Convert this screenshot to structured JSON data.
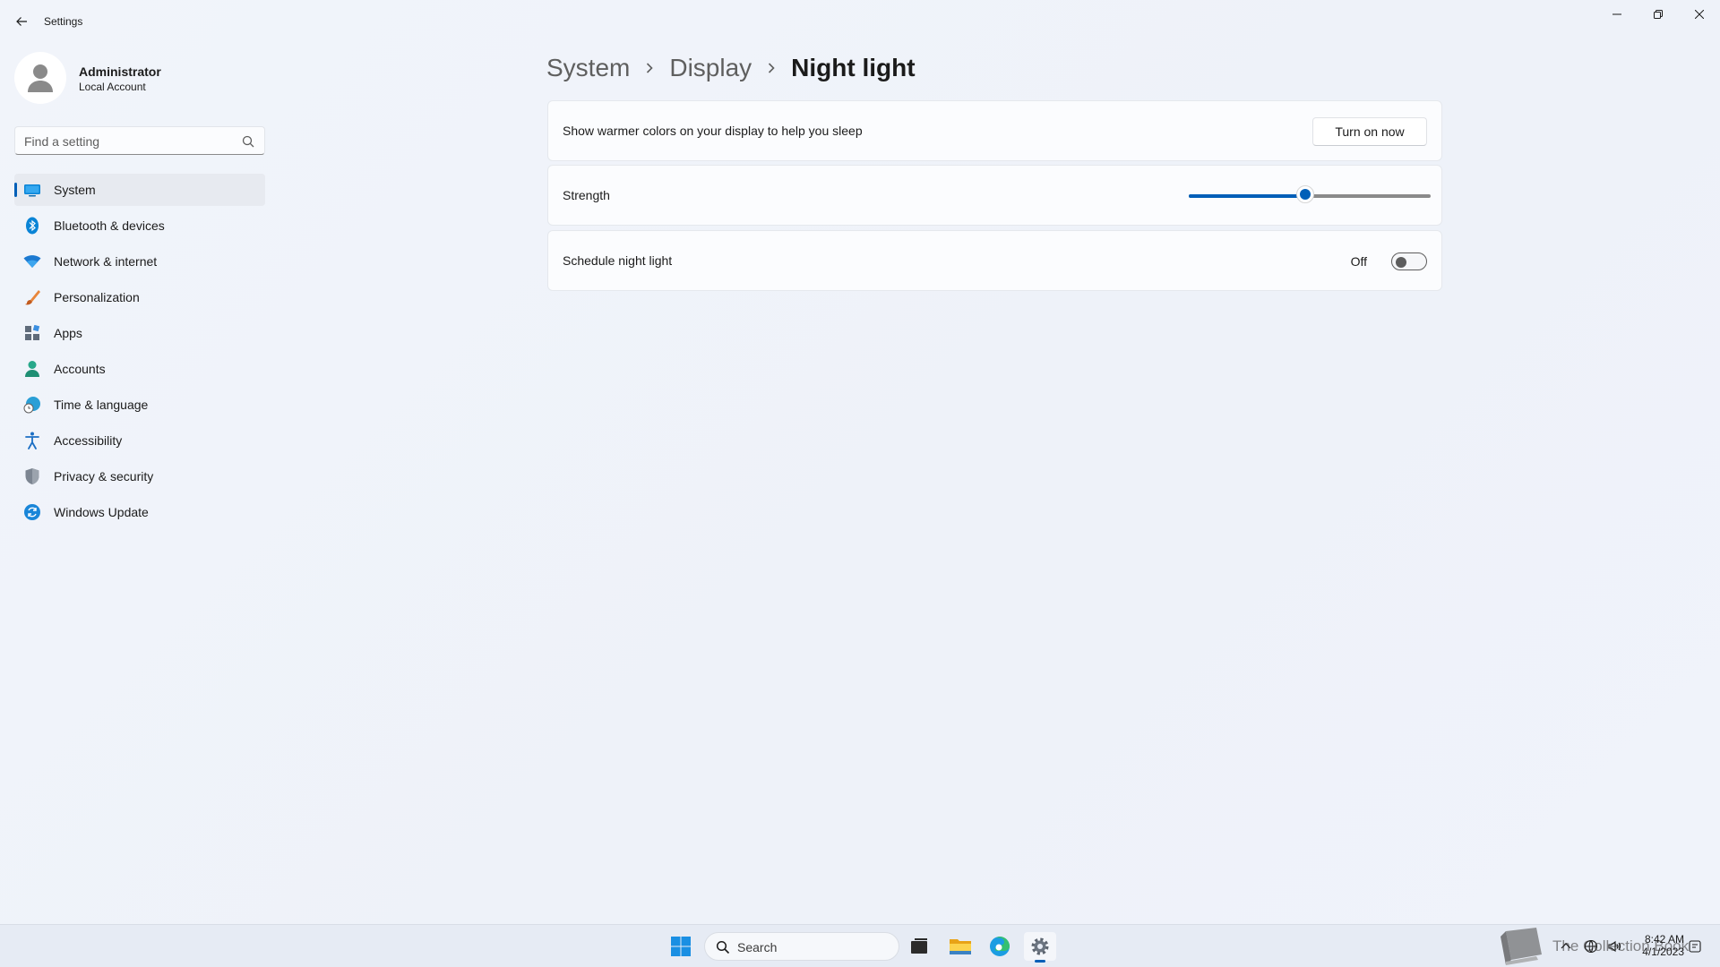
{
  "window": {
    "title": "Settings",
    "controls": [
      "minimize",
      "restore",
      "close"
    ]
  },
  "profile": {
    "name": "Administrator",
    "account_type": "Local Account"
  },
  "search": {
    "placeholder": "Find a setting",
    "icon": "search-icon"
  },
  "sidebar": {
    "items": [
      {
        "label": "System",
        "icon": "system-icon",
        "active": true
      },
      {
        "label": "Bluetooth & devices",
        "icon": "bluetooth-icon"
      },
      {
        "label": "Network & internet",
        "icon": "wifi-icon"
      },
      {
        "label": "Personalization",
        "icon": "brush-icon"
      },
      {
        "label": "Apps",
        "icon": "apps-icon"
      },
      {
        "label": "Accounts",
        "icon": "person-icon"
      },
      {
        "label": "Time & language",
        "icon": "globe-clock-icon"
      },
      {
        "label": "Accessibility",
        "icon": "accessibility-icon"
      },
      {
        "label": "Privacy & security",
        "icon": "shield-icon"
      },
      {
        "label": "Windows Update",
        "icon": "update-icon"
      }
    ]
  },
  "breadcrumb": {
    "items": [
      "System",
      "Display"
    ],
    "current": "Night light"
  },
  "night_light": {
    "description": "Show warmer colors on your display to help you sleep",
    "turn_on_button": "Turn on now",
    "strength_label": "Strength",
    "strength_fraction": 0.48,
    "schedule_label": "Schedule night light",
    "schedule_state": "Off",
    "schedule_on": false
  },
  "taskbar": {
    "search_label": "Search",
    "apps": [
      "start-icon",
      "task-view-icon",
      "file-explorer-icon",
      "edge-icon",
      "settings-icon"
    ],
    "watermark": "The Collection Book",
    "time": "8:42 AM",
    "date": "4/1/2023"
  },
  "colors": {
    "accent": "#005fb8",
    "background": "#eef2f9",
    "card": "#fbfcfe"
  }
}
